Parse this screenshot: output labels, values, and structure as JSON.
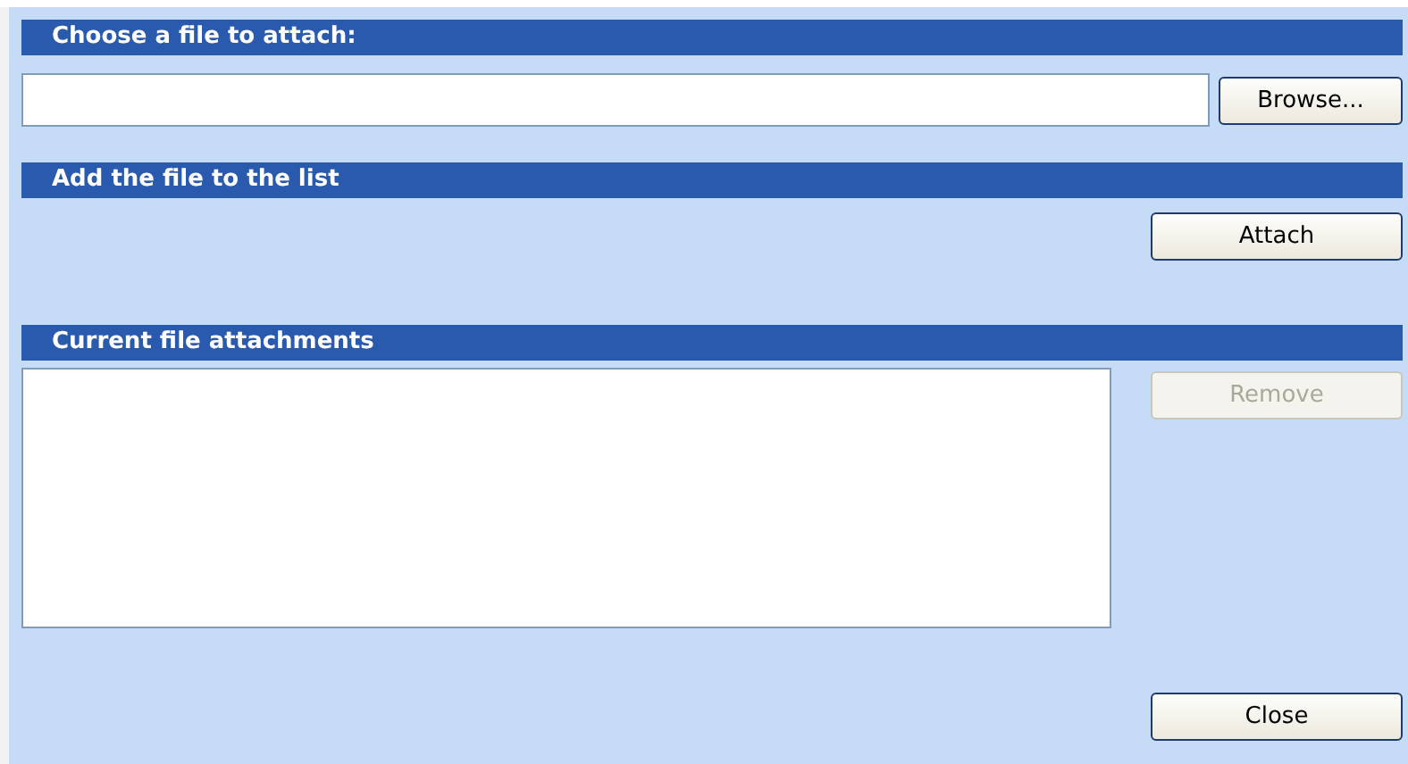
{
  "sections": [
    {
      "title": "Choose a file to attach:",
      "kind": "file-picker",
      "button": {
        "label": "Browse...",
        "disabled": false
      }
    },
    {
      "title": "Add the file to the list",
      "kind": "action",
      "button": {
        "label": "Attach",
        "disabled": false
      }
    },
    {
      "title": "Current file attachments",
      "kind": "list",
      "button": {
        "label": "Remove",
        "disabled": true
      }
    }
  ],
  "footer_button": {
    "label": "Close",
    "disabled": false
  }
}
